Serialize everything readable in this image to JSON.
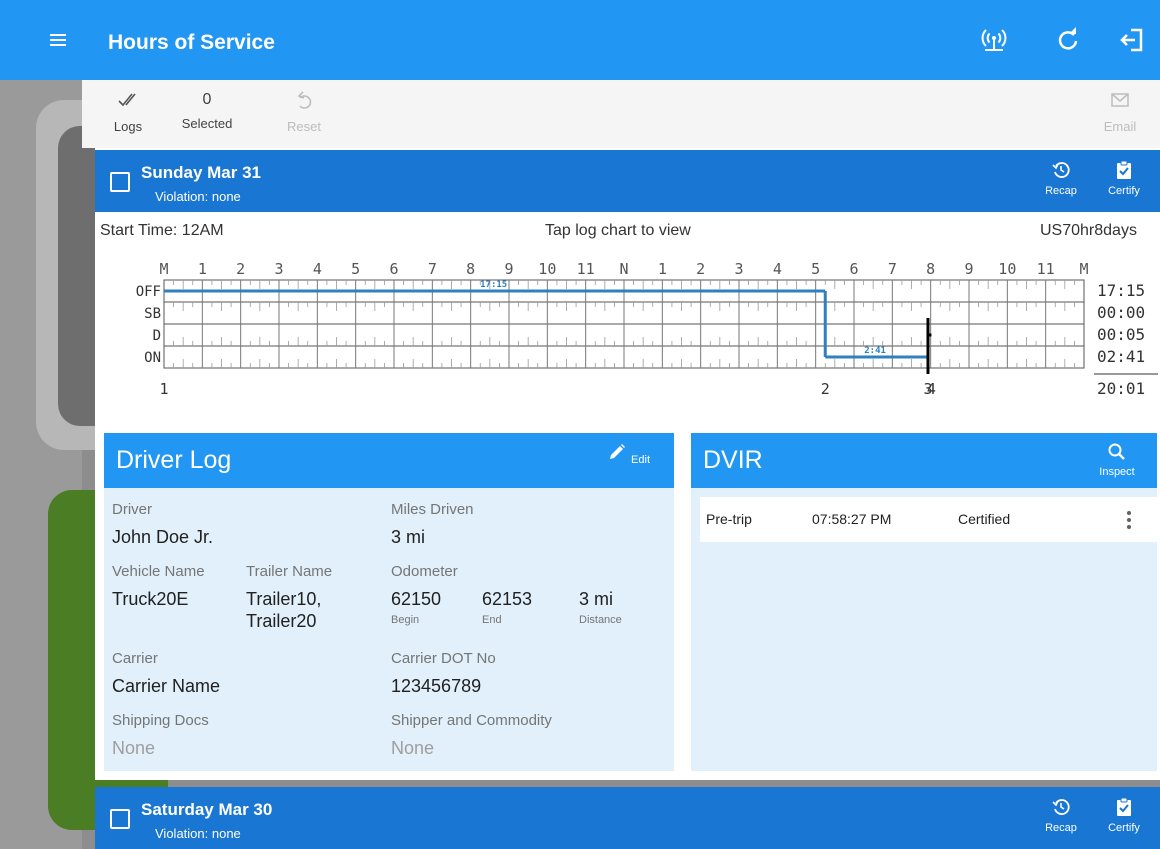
{
  "app": {
    "title": "Hours of Service"
  },
  "toolbar": {
    "logs_label": "Logs",
    "selected_count": "0",
    "selected_label": "Selected",
    "reset_label": "Reset",
    "email_label": "Email"
  },
  "day1": {
    "date": "Sunday Mar 31",
    "violation": "Violation: none",
    "recap": "Recap",
    "certify": "Certify",
    "start_time": "Start Time: 12AM",
    "tap_hint": "Tap log chart to view",
    "ruleset": "US70hr8days"
  },
  "chart_data": {
    "type": "line",
    "hour_labels": [
      "M",
      "1",
      "2",
      "3",
      "4",
      "5",
      "6",
      "7",
      "8",
      "9",
      "10",
      "11",
      "N",
      "1",
      "2",
      "3",
      "4",
      "5",
      "6",
      "7",
      "8",
      "9",
      "10",
      "11",
      "M"
    ],
    "statuses": [
      "OFF",
      "SB",
      "D",
      "ON"
    ],
    "totals": [
      "17:15",
      "00:00",
      "00:05",
      "02:41"
    ],
    "grand_total": "20:01",
    "segments": [
      {
        "status": "OFF",
        "start_hr": 0,
        "end_hr": 17.25
      },
      {
        "status": "ON",
        "start_hr": 17.25,
        "end_hr": 19.93
      },
      {
        "status": "D",
        "start_hr": 19.93,
        "end_hr": 20.02
      }
    ],
    "segment_labels": [
      {
        "text": "17:15",
        "hr": 8.6,
        "status": "OFF"
      },
      {
        "text": "2:41",
        "hr": 18.55,
        "status": "ON"
      }
    ],
    "markers": [
      {
        "text": "1",
        "hr": 0
      },
      {
        "text": "2",
        "hr": 17.25
      },
      {
        "text": "3",
        "hr": 19.93
      },
      {
        "text": "4",
        "hr": 20.02
      }
    ]
  },
  "driver_log": {
    "title": "Driver Log",
    "edit": "Edit",
    "driver_label": "Driver",
    "driver": "John Doe Jr.",
    "miles_label": "Miles Driven",
    "miles": "3 mi",
    "vehicle_label": "Vehicle Name",
    "vehicle": "Truck20E",
    "trailer_label": "Trailer Name",
    "trailer1": "Trailer10,",
    "trailer2": "Trailer20",
    "odometer_label": "Odometer",
    "odo_begin": "62150",
    "odo_begin_label": "Begin",
    "odo_end": "62153",
    "odo_end_label": "End",
    "distance": "3 mi",
    "distance_label": "Distance",
    "carrier_label": "Carrier",
    "carrier": "Carrier Name",
    "dot_label": "Carrier DOT No",
    "dot": "123456789",
    "shipping_label": "Shipping Docs",
    "shipping": "None",
    "shipper_label": "Shipper and Commodity",
    "shipper": "None"
  },
  "dvir": {
    "title": "DVIR",
    "inspect": "Inspect",
    "type": "Pre-trip",
    "time": "07:58:27 PM",
    "status": "Certified"
  },
  "day2": {
    "date": "Saturday Mar 30",
    "violation": "Violation: none",
    "recap": "Recap",
    "certify": "Certify"
  }
}
